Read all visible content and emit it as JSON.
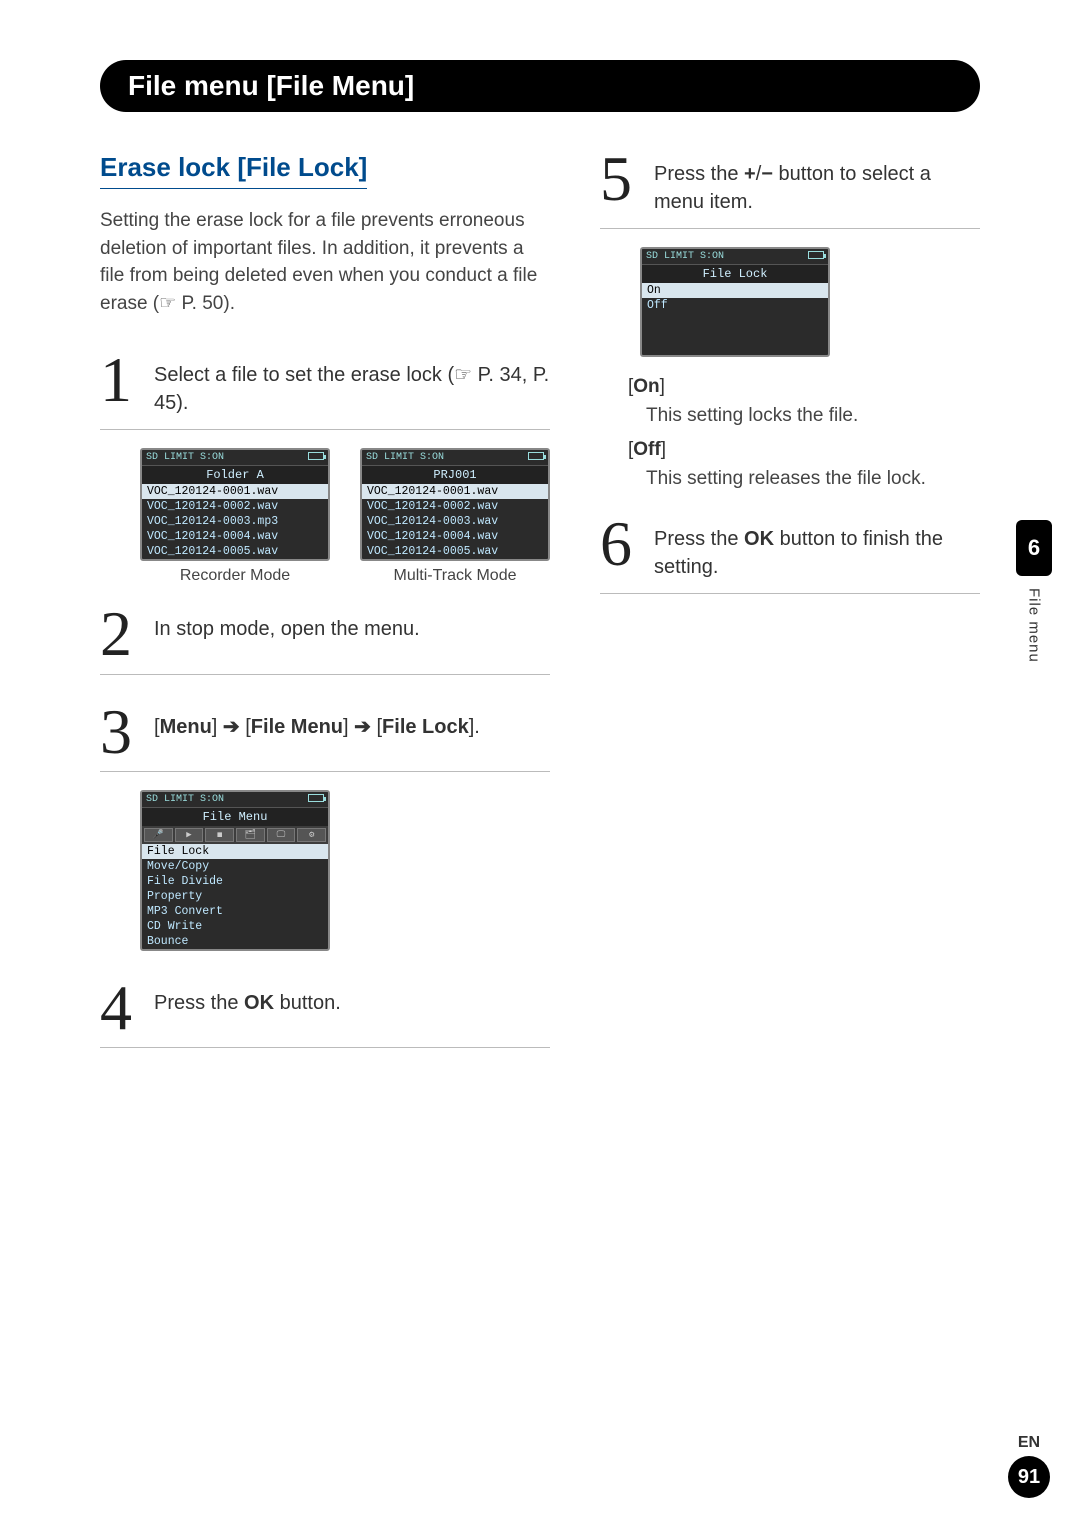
{
  "header": "File menu [File Menu]",
  "section_title": "Erase lock [File Lock]",
  "intro": "Setting the erase lock for a file prevents erroneous deletion of important files. In addition, it prevents a file from being deleted even when you conduct a file erase (☞ P. 50).",
  "steps": {
    "1": {
      "num": "1",
      "text_a": "Select a file to set the erase lock (",
      "ref": "☞ P. 34, P. 45",
      "text_b": ")."
    },
    "2": {
      "num": "2",
      "text": "In stop mode, open the menu."
    },
    "3": {
      "num": "3",
      "parts": [
        "[",
        "Menu",
        "] ",
        "➔",
        " [",
        "File Menu",
        "] ",
        "➔",
        " [",
        "File Lock",
        "]."
      ]
    },
    "4": {
      "num": "4",
      "parts": [
        "Press the ",
        "OK",
        " button."
      ]
    },
    "5": {
      "num": "5",
      "parts": [
        "Press the ",
        "+",
        "/",
        "−",
        " button to select a menu item."
      ]
    },
    "6": {
      "num": "6",
      "parts": [
        "Press the ",
        "OK",
        " button to finish the setting."
      ]
    }
  },
  "screens": {
    "recorder": {
      "title": "Folder A",
      "rows": [
        "VOC_120124-0001.wav",
        "VOC_120124-0002.wav",
        "VOC_120124-0003.mp3",
        "VOC_120124-0004.wav",
        "VOC_120124-0005.wav"
      ],
      "caption": "Recorder Mode"
    },
    "multitrack": {
      "title": "PRJ001",
      "rows": [
        "VOC_120124-0001.wav",
        "VOC_120124-0002.wav",
        "VOC_120124-0003.wav",
        "VOC_120124-0004.wav",
        "VOC_120124-0005.wav"
      ],
      "caption": "Multi-Track Mode"
    },
    "file_menu": {
      "title": "File Menu",
      "rows": [
        "File Lock",
        "Move/Copy",
        "File Divide",
        "Property",
        "MP3 Convert",
        "CD Write",
        "Bounce"
      ]
    },
    "file_lock": {
      "title": "File Lock",
      "rows": [
        "On",
        "Off"
      ]
    }
  },
  "options": {
    "on_label": "[On]",
    "on_desc": "This setting locks the file.",
    "off_label": "[Off]",
    "off_desc": "This setting releases the file lock."
  },
  "side": {
    "chapter": "6",
    "label": "File menu"
  },
  "footer": {
    "lang": "EN",
    "page": "91"
  },
  "status_bar": "SD  LIMIT  S:ON"
}
